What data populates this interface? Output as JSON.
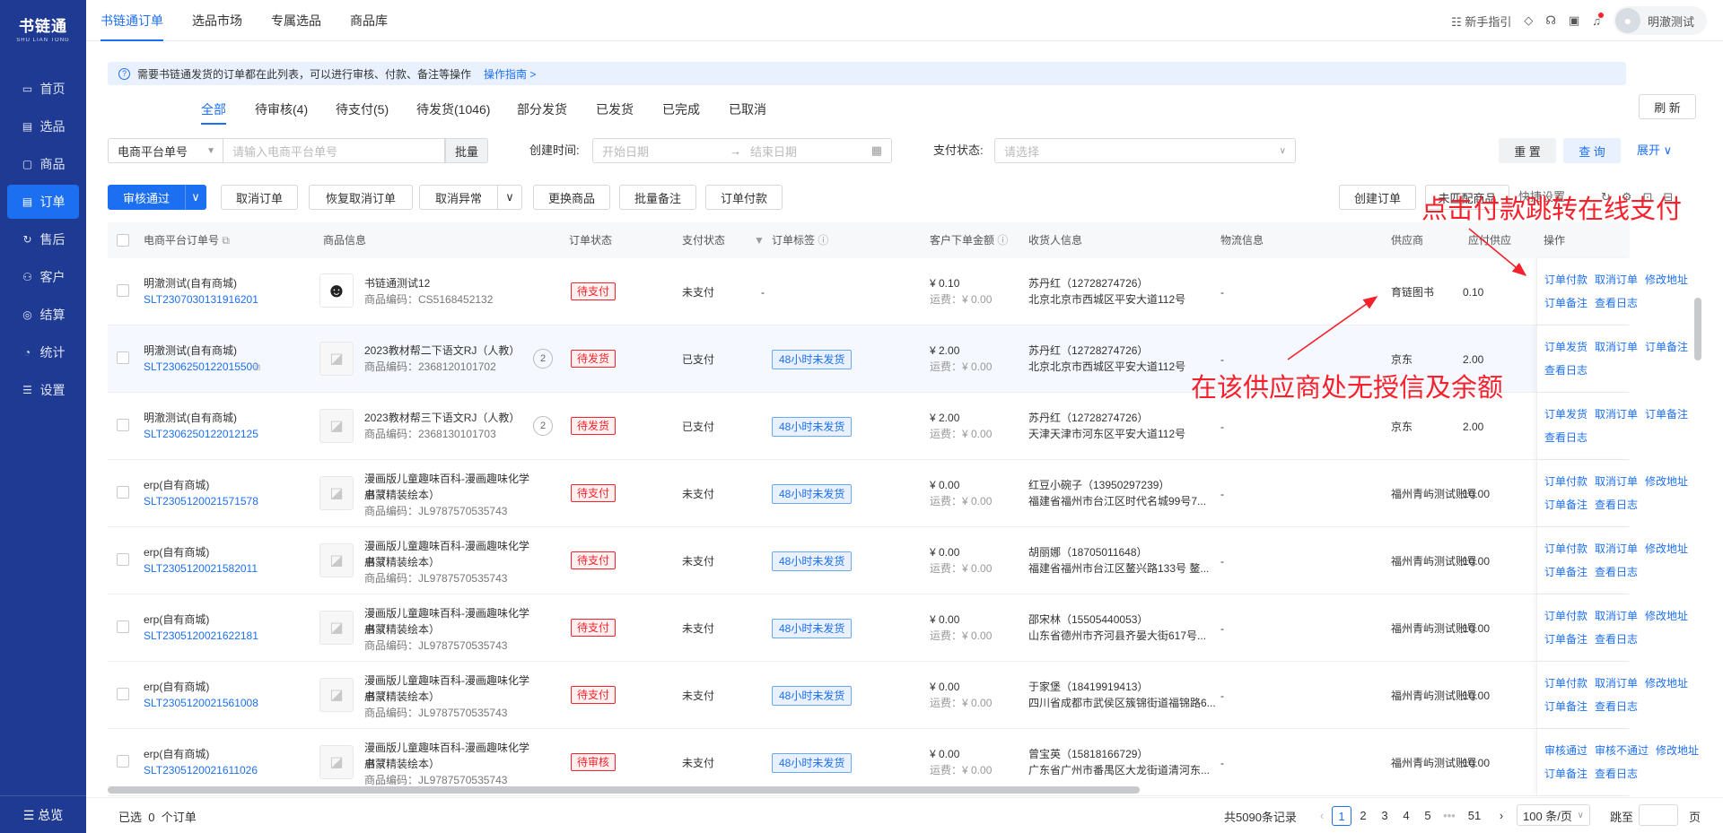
{
  "brand": {
    "name_cn": "书链通",
    "name_en": "SHU LIAN TONG"
  },
  "sidebar": {
    "items": [
      {
        "label": "首页",
        "icon": "monitor-icon"
      },
      {
        "label": "选品",
        "icon": "clipboard-icon"
      },
      {
        "label": "商品",
        "icon": "box-icon"
      },
      {
        "label": "订单",
        "icon": "document-icon"
      },
      {
        "label": "售后",
        "icon": "refresh-icon"
      },
      {
        "label": "客户",
        "icon": "users-icon"
      },
      {
        "label": "结算",
        "icon": "coin-icon"
      },
      {
        "label": "统计",
        "icon": "chart-icon"
      },
      {
        "label": "设置",
        "icon": "sliders-icon"
      }
    ],
    "bottom": "☰ 总览"
  },
  "topnav": {
    "tabs": [
      "书链通订单",
      "选品市场",
      "专属选品",
      "商品库"
    ],
    "guide": "新手指引",
    "user": "明澈测试"
  },
  "notice": {
    "text": "需要书链通发货的订单都在此列表，可以进行审核、付款、备注等操作",
    "link": "操作指南 >"
  },
  "status_tabs": [
    "全部",
    "待审核(4)",
    "待支付(5)",
    "待发货(1046)",
    "部分发货",
    "已发货",
    "已完成",
    "已取消"
  ],
  "refresh": "刷 新",
  "filters": {
    "platform_select": "电商平台单号",
    "platform_placeholder": "请输入电商平台单号",
    "batch": "批量",
    "created_label": "创建时间:",
    "start_placeholder": "开始日期",
    "end_placeholder": "结束日期",
    "pay_label": "支付状态:",
    "pay_placeholder": "请选择",
    "reset": "重 置",
    "query": "查 询",
    "expand": "展开"
  },
  "actions": {
    "approve": "审核通过",
    "cancel_order": "取消订单",
    "restore_cancel": "恢复取消订单",
    "cancel_abnormal": "取消异常",
    "change_goods": "更换商品",
    "batch_note": "批量备注",
    "pay_order": "订单付款",
    "create_order": "创建订单",
    "unmatched": "未匹配商品",
    "quick_settings": "快捷设置"
  },
  "columns": [
    "电商平台订单号",
    "商品信息",
    "订单状态",
    "支付状态",
    "订单标签",
    "客户下单金额",
    "收货人信息",
    "物流信息",
    "供应商",
    "应付供应",
    "操作"
  ],
  "rows": [
    {
      "shop": "明澈测试(自有商城)",
      "order_no": "SLT2307030131916201",
      "goods_name": "书链通测试12",
      "goods_name2": "",
      "code": "商品编码：CS5168452132",
      "count": "",
      "status": "待支付",
      "pay": "未支付",
      "tag": "-",
      "amount": "¥ 0.10",
      "freight": "运费：¥ 0.00",
      "receiver": "苏丹红（12728274726）",
      "address": "北京北京市西城区平安大道112号",
      "logistics": "-",
      "supplier": "育链图书",
      "payable": "0.10",
      "ops": [
        "订单付款",
        "取消订单",
        "修改地址",
        "订单备注",
        "查看日志"
      ]
    },
    {
      "shop": "明澈测试(自有商城)",
      "order_no": "SLT2306250122015500",
      "goods_name": "2023教材帮二下语文RJ（人教）",
      "goods_name2": "",
      "code": "商品编码：2368120101702",
      "count": "2",
      "status": "待发货",
      "pay": "已支付",
      "tag": "48小时未发货",
      "amount": "¥ 2.00",
      "freight": "运费：¥ 0.00",
      "receiver": "苏丹红（12728274726）",
      "address": "北京北京市西城区平安大道112号",
      "logistics": "-",
      "supplier": "京东",
      "payable": "2.00",
      "ops": [
        "订单发货",
        "取消订单",
        "订单备注",
        "查看日志"
      ]
    },
    {
      "shop": "明澈测试(自有商城)",
      "order_no": "SLT2306250122012125",
      "goods_name": "2023教材帮三下语文RJ（人教）",
      "goods_name2": "",
      "code": "商品编码：2368130101703",
      "count": "2",
      "status": "待发货",
      "pay": "已支付",
      "tag": "48小时未发货",
      "amount": "¥ 2.00",
      "freight": "运费：¥ 0.00",
      "receiver": "苏丹红（12728274726）",
      "address": "天津天津市河东区平安大道112号",
      "logistics": "-",
      "supplier": "京东",
      "payable": "2.00",
      "ops": [
        "订单发货",
        "取消订单",
        "订单备注",
        "查看日志"
      ]
    },
    {
      "shop": "erp(自有商城)",
      "order_no": "SLT2305120021571578",
      "goods_name": "漫画版儿童趣味百科-漫画趣味化学启蒙",
      "goods_name2": "书（精装绘本）",
      "code": "商品编码：JL9787570535743",
      "count": "",
      "status": "待支付",
      "pay": "未支付",
      "tag": "48小时未发货",
      "amount": "¥ 0.00",
      "freight": "运费：¥ 0.00",
      "receiver": "红豆小碗子（13950297239）",
      "address": "福建省福州市台江区时代名城99号7...",
      "logistics": "-",
      "supplier": "福州青屿测试账号",
      "payable": "10.00",
      "ops": [
        "订单付款",
        "取消订单",
        "修改地址",
        "订单备注",
        "查看日志"
      ]
    },
    {
      "shop": "erp(自有商城)",
      "order_no": "SLT2305120021582011",
      "goods_name": "漫画版儿童趣味百科-漫画趣味化学启蒙",
      "goods_name2": "书（精装绘本）",
      "code": "商品编码：JL9787570535743",
      "count": "",
      "status": "待支付",
      "pay": "未支付",
      "tag": "48小时未发货",
      "amount": "¥ 0.00",
      "freight": "运费：¥ 0.00",
      "receiver": "胡丽娜（18705011648）",
      "address": "福建省福州市台江区鳌兴路133号 鳌...",
      "logistics": "-",
      "supplier": "福州青屿测试账号",
      "payable": "10.00",
      "ops": [
        "订单付款",
        "取消订单",
        "修改地址",
        "订单备注",
        "查看日志"
      ]
    },
    {
      "shop": "erp(自有商城)",
      "order_no": "SLT2305120021622181",
      "goods_name": "漫画版儿童趣味百科-漫画趣味化学启蒙",
      "goods_name2": "书（精装绘本）",
      "code": "商品编码：JL9787570535743",
      "count": "",
      "status": "待支付",
      "pay": "未支付",
      "tag": "48小时未发货",
      "amount": "¥ 0.00",
      "freight": "运费：¥ 0.00",
      "receiver": "邵宋林（15505440053）",
      "address": "山东省德州市齐河县齐晏大街617号...",
      "logistics": "-",
      "supplier": "福州青屿测试账号",
      "payable": "10.00",
      "ops": [
        "订单付款",
        "取消订单",
        "修改地址",
        "订单备注",
        "查看日志"
      ]
    },
    {
      "shop": "erp(自有商城)",
      "order_no": "SLT2305120021561008",
      "goods_name": "漫画版儿童趣味百科-漫画趣味化学启蒙",
      "goods_name2": "书（精装绘本）",
      "code": "商品编码：JL9787570535743",
      "count": "",
      "status": "待支付",
      "pay": "未支付",
      "tag": "48小时未发货",
      "amount": "¥ 0.00",
      "freight": "运费：¥ 0.00",
      "receiver": "于家堡（18419919413）",
      "address": "四川省成都市武侯区簇锦街道福锦路6...",
      "logistics": "-",
      "supplier": "福州青屿测试账号",
      "payable": "10.00",
      "ops": [
        "订单付款",
        "取消订单",
        "修改地址",
        "订单备注",
        "查看日志"
      ]
    },
    {
      "shop": "erp(自有商城)",
      "order_no": "SLT2305120021611026",
      "goods_name": "漫画版儿童趣味百科-漫画趣味化学启蒙",
      "goods_name2": "书（精装绘本）",
      "code": "商品编码：JL9787570535743",
      "count": "",
      "status": "待审核",
      "pay": "未支付",
      "tag": "48小时未发货",
      "amount": "¥ 0.00",
      "freight": "运费：¥ 0.00",
      "receiver": "曾宝英（15818166729）",
      "address": "广东省广州市番禺区大龙街道清河东...",
      "logistics": "-",
      "supplier": "福州青屿测试账号",
      "payable": "10.00",
      "ops": [
        "审核通过",
        "审核不通过",
        "修改地址",
        "订单备注",
        "查看日志"
      ]
    }
  ],
  "footer": {
    "selected_prefix": "已选",
    "selected_count": "0",
    "selected_suffix": "个订单",
    "total": "共5090条记录",
    "pages": [
      "1",
      "2",
      "3",
      "4",
      "5",
      "•••",
      "51"
    ],
    "page_size": "100 条/页",
    "goto_label": "跳至",
    "page_unit": "页"
  },
  "annotations": {
    "top": "点击付款跳转在线支付",
    "mid": "在该供应商处无授信及余额"
  },
  "colors": {
    "primary": "#1d6ff2",
    "sidebar": "#1f3a93",
    "annotation": "#f5222d"
  }
}
